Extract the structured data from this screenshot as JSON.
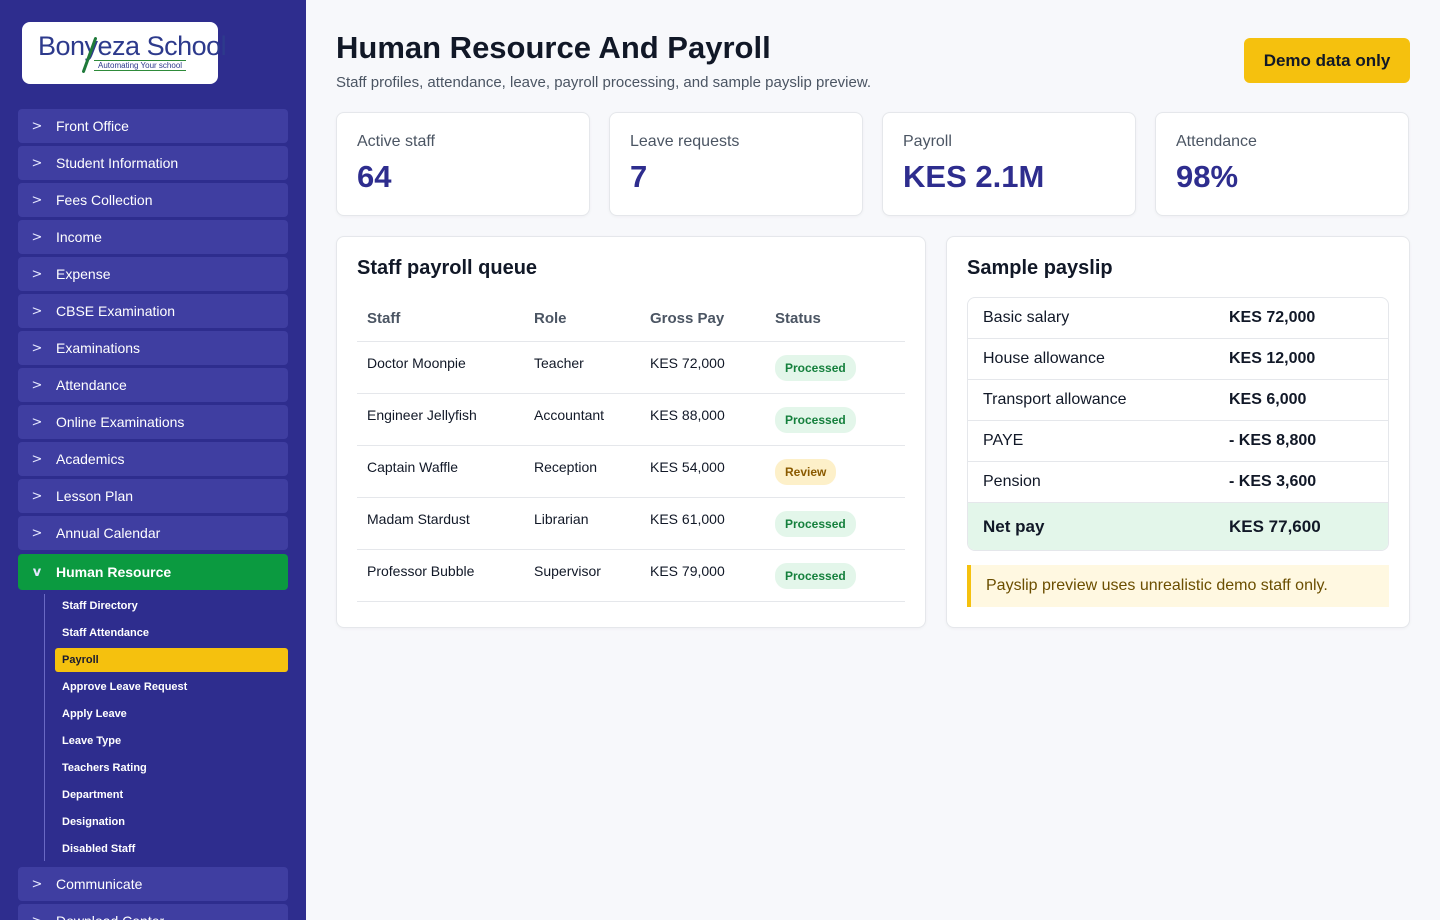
{
  "brand": {
    "logo_text": "Bonyeza School",
    "tagline": "Automating Your school"
  },
  "sidebar": {
    "items_top": [
      {
        "label": "Front Office"
      },
      {
        "label": "Student Information"
      },
      {
        "label": "Fees Collection"
      },
      {
        "label": "Income"
      },
      {
        "label": "Expense"
      },
      {
        "label": "CBSE Examination"
      },
      {
        "label": "Examinations"
      },
      {
        "label": "Attendance"
      },
      {
        "label": "Online Examinations"
      },
      {
        "label": "Academics"
      },
      {
        "label": "Lesson Plan"
      },
      {
        "label": "Annual Calendar"
      }
    ],
    "active": {
      "label": "Human Resource",
      "chevron": "v"
    },
    "collapsed_chevron": ">",
    "sub_items": [
      {
        "label": "Staff Directory"
      },
      {
        "label": "Staff Attendance"
      },
      {
        "label": "Payroll",
        "active": true
      },
      {
        "label": "Approve Leave Request"
      },
      {
        "label": "Apply Leave"
      },
      {
        "label": "Leave Type"
      },
      {
        "label": "Teachers Rating"
      },
      {
        "label": "Department"
      },
      {
        "label": "Designation"
      },
      {
        "label": "Disabled Staff"
      }
    ],
    "items_bottom": [
      {
        "label": "Communicate"
      },
      {
        "label": "Download Center"
      }
    ]
  },
  "header": {
    "title": "Human Resource And Payroll",
    "subtitle": "Staff profiles, attendance, leave, payroll processing, and sample payslip preview.",
    "demo_button": "Demo data only"
  },
  "stats": [
    {
      "label": "Active staff",
      "value": "64"
    },
    {
      "label": "Leave requests",
      "value": "7"
    },
    {
      "label": "Payroll",
      "value": "KES 2.1M"
    },
    {
      "label": "Attendance",
      "value": "98%"
    }
  ],
  "payroll_queue": {
    "title": "Staff payroll queue",
    "columns": [
      "Staff",
      "Role",
      "Gross Pay",
      "Status"
    ],
    "rows": [
      {
        "staff": "Doctor Moonpie",
        "role": "Teacher",
        "gross": "KES 72,000",
        "status": "Processed"
      },
      {
        "staff": "Engineer Jellyfish",
        "role": "Accountant",
        "gross": "KES 88,000",
        "status": "Processed"
      },
      {
        "staff": "Captain Waffle",
        "role": "Reception",
        "gross": "KES 54,000",
        "status": "Review"
      },
      {
        "staff": "Madam Stardust",
        "role": "Librarian",
        "gross": "KES 61,000",
        "status": "Processed"
      },
      {
        "staff": "Professor Bubble",
        "role": "Supervisor",
        "gross": "KES 79,000",
        "status": "Processed"
      }
    ]
  },
  "payslip": {
    "title": "Sample payslip",
    "rows": [
      {
        "label": "Basic salary",
        "value": "KES 72,000"
      },
      {
        "label": "House allowance",
        "value": "KES 12,000"
      },
      {
        "label": "Transport allowance",
        "value": "KES 6,000"
      },
      {
        "label": "PAYE",
        "value": "- KES 8,800"
      },
      {
        "label": "Pension",
        "value": "- KES 3,600"
      }
    ],
    "net": {
      "label": "Net pay",
      "value": "KES 77,600"
    },
    "note": "Payslip preview uses unrealistic demo staff only."
  },
  "colors": {
    "sidebar_bg": "#2e2d8e",
    "accent_green": "#0b9a40",
    "accent_yellow": "#f5c10e",
    "stat_value": "#2e2d8e"
  }
}
